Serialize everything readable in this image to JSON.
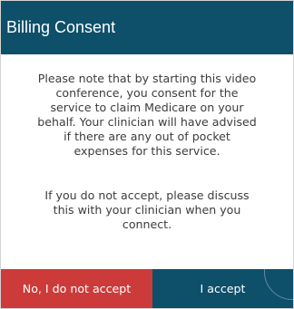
{
  "dialog": {
    "title": "Billing Consent",
    "paragraph_1": "Please note that by starting this video conference, you consent for the service to claim Medicare on your behalf. Your clinician will have advised if there are any out of pocket expenses for this service.",
    "paragraph_2": "If you do not accept, please discuss this with your clinician when you connect.",
    "decline_label": "No, I do not accept",
    "accept_label": "I accept"
  },
  "colors": {
    "header_bg": "#0e4f6a",
    "decline_bg": "#cc3b3a",
    "accept_bg": "#0e4f6a"
  }
}
